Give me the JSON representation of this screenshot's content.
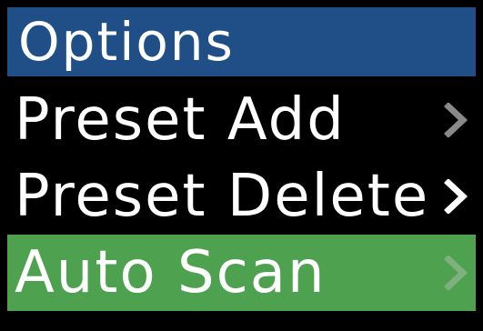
{
  "header": {
    "title": "Options",
    "background": "#1f4f86"
  },
  "menu": {
    "selected_color": "#4ea24f",
    "items": [
      {
        "label": "Preset Add",
        "icon": "chevron-right-icon",
        "chevron_color": "#8a8a8a",
        "selected": false
      },
      {
        "label": "Preset Delete",
        "icon": "chevron-right-icon",
        "chevron_color": "#ffffff",
        "selected": false
      },
      {
        "label": "Auto Scan",
        "icon": "chevron-right-icon",
        "chevron_color": "#7fb07f",
        "selected": true
      }
    ]
  }
}
